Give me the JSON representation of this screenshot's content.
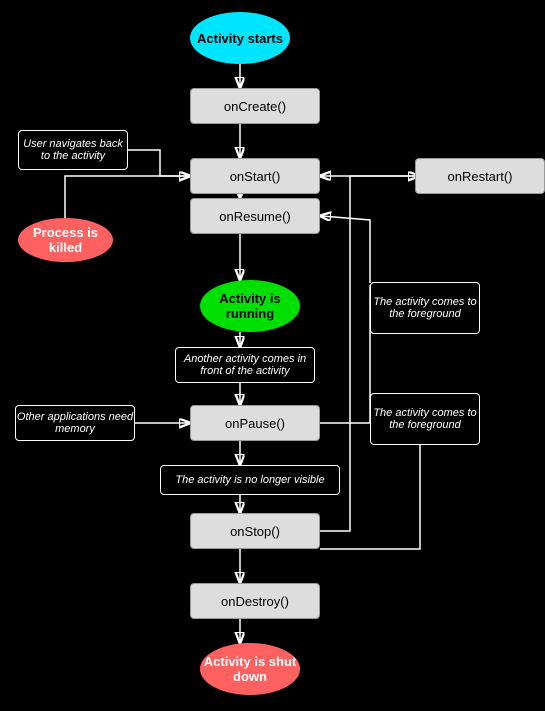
{
  "nodes": {
    "activity_starts": "Activity starts",
    "oncreate": "onCreate()",
    "onstart": "onStart()",
    "onrestart": "onRestart()",
    "onresume": "onResume()",
    "activity_running": "Activity is running",
    "activity_comes_fg1": "The activity comes to the foreground",
    "another_activity": "Another activity comes in front of the activity",
    "other_applications": "Other applications need memory",
    "activity_comes_fg2": "The activity comes to the foreground",
    "onpause": "onPause()",
    "no_longer_visible": "The activity is no longer visible",
    "onstop": "onStop()",
    "ondestroy": "onDestroy()",
    "activity_shutdown": "Activity is shut down",
    "user_navigates": "User navigates back to the activity",
    "process_killed": "Process is killed"
  }
}
